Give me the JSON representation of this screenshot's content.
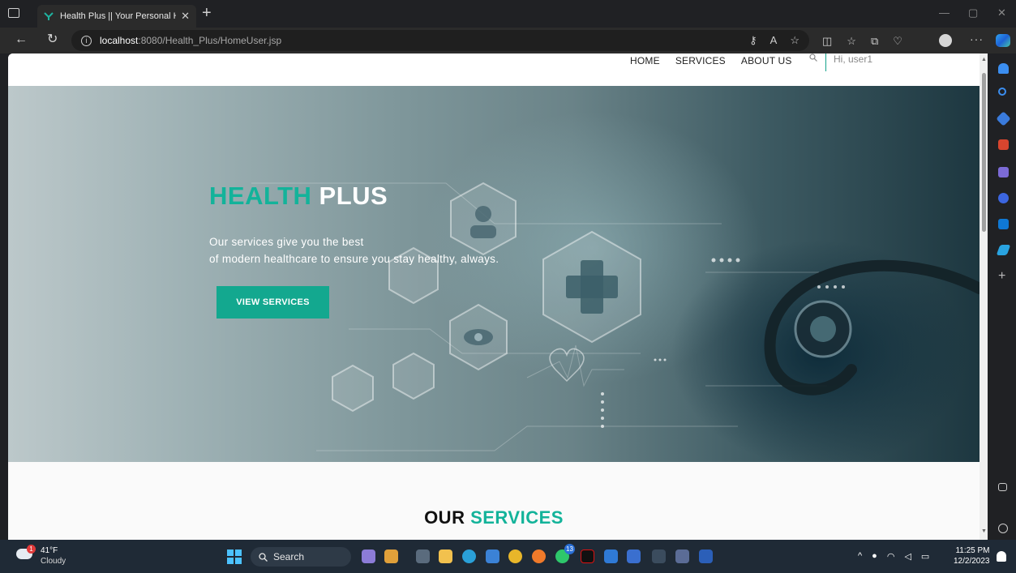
{
  "browser": {
    "tab_title": "Health Plus || Your Personal Healt",
    "tab_close": "✕",
    "new_tab": "+",
    "url_host": "localhost",
    "url_path": ":8080/Health_Plus/HomeUser.jsp",
    "accent": "#2fa4f0"
  },
  "site": {
    "nav": {
      "home": "HOME",
      "services": "SERVICES",
      "about": "ABOUT US"
    },
    "greeting": "Hi, user1",
    "hero": {
      "title_accent": "HEALTH",
      "title_main": "PLUS",
      "line1": "Our services give you the best",
      "line2": "of modern healthcare to ensure you stay healthy, always.",
      "button": "VIEW SERVICES"
    },
    "services_heading": {
      "part1": "OUR",
      "part2": "SERVICES"
    },
    "brand_color": "#13b39a"
  },
  "taskbar": {
    "weather_temp": "41°F",
    "weather_condition": "Cloudy",
    "weather_badge": "1",
    "search_label": "Search",
    "time": "11:25 PM",
    "date": "12/2/2023",
    "whatsapp_badge": "13"
  }
}
